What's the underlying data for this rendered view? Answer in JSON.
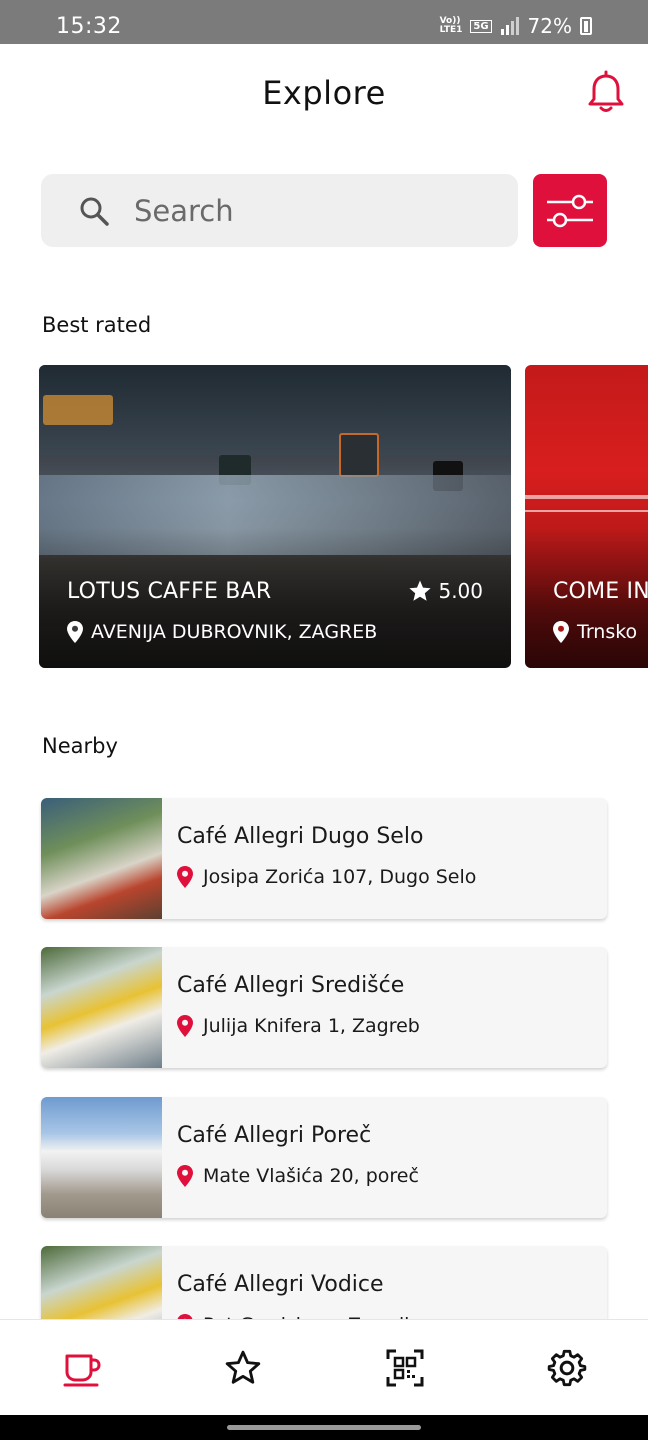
{
  "status_bar": {
    "time": "15:32",
    "network_top": "Vo))",
    "network_bottom": "LTE1",
    "network_type": "5G",
    "battery": "72%"
  },
  "header": {
    "title": "Explore",
    "bell_icon": "bell-icon"
  },
  "search": {
    "placeholder": "Search",
    "icon": "search-icon",
    "filter_icon": "sliders-icon"
  },
  "best_rated": {
    "title": "Best rated",
    "cards": [
      {
        "name": "LOTUS CAFFE BAR",
        "address": "AVENIJA DUBROVNIK, ZAGREB",
        "rating": "5.00"
      },
      {
        "name": "COME IN",
        "address": "Trnsko"
      }
    ]
  },
  "nearby": {
    "title": "Nearby",
    "items": [
      {
        "name": "Café Allegri Dugo Selo",
        "address": "Josipa Zorića 107, Dugo Selo"
      },
      {
        "name": "Café Allegri Središće",
        "address": "Julija Knifera 1, Zagreb"
      },
      {
        "name": "Café Allegri Poreč",
        "address": "Mate Vlašića 20, poreč"
      },
      {
        "name": "Café Allegri Vodice",
        "address": "Put Gradske ... Zaradi..."
      }
    ]
  },
  "bottom_nav": {
    "items": [
      "coffee-cup-icon",
      "star-icon",
      "qr-code-icon",
      "gear-icon"
    ],
    "active": "coffee-cup-icon"
  },
  "colors": {
    "accent": "#e0103c",
    "search_bg": "#efefef",
    "card_bg": "#f6f6f6"
  }
}
